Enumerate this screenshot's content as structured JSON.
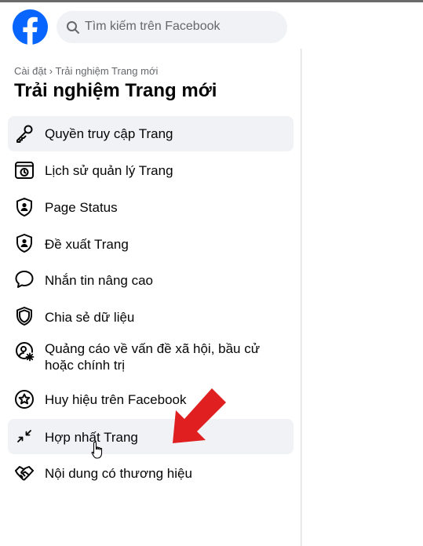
{
  "search": {
    "placeholder": "Tìm kiếm trên Facebook"
  },
  "breadcrumb": "Cài đặt › Trải nghiệm Trang mới",
  "page_title": "Trải nghiệm Trang mới",
  "menu": [
    {
      "label": "Quyền truy cập Trang",
      "icon": "key-icon",
      "state": "selected"
    },
    {
      "label": "Lịch sử quản lý Trang",
      "icon": "history-icon"
    },
    {
      "label": "Page Status",
      "icon": "shield-person-icon"
    },
    {
      "label": "Đề xuất Trang",
      "icon": "shield-person-icon"
    },
    {
      "label": "Nhắn tin nâng cao",
      "icon": "chat-bubble-icon"
    },
    {
      "label": "Chia sẻ dữ liệu",
      "icon": "shield-icon"
    },
    {
      "label": "Quảng cáo về vấn đề xã hội, bầu cử hoặc chính trị",
      "icon": "person-gear-icon"
    },
    {
      "label": "Huy hiệu trên Facebook",
      "icon": "star-badge-icon"
    },
    {
      "label": "Hợp nhất Trang",
      "icon": "merge-arrows-icon",
      "state": "hovered"
    },
    {
      "label": "Nội dung có thương hiệu",
      "icon": "handshake-icon"
    }
  ],
  "colors": {
    "brand": "#0866ff",
    "annotation_arrow": "#e02020"
  }
}
